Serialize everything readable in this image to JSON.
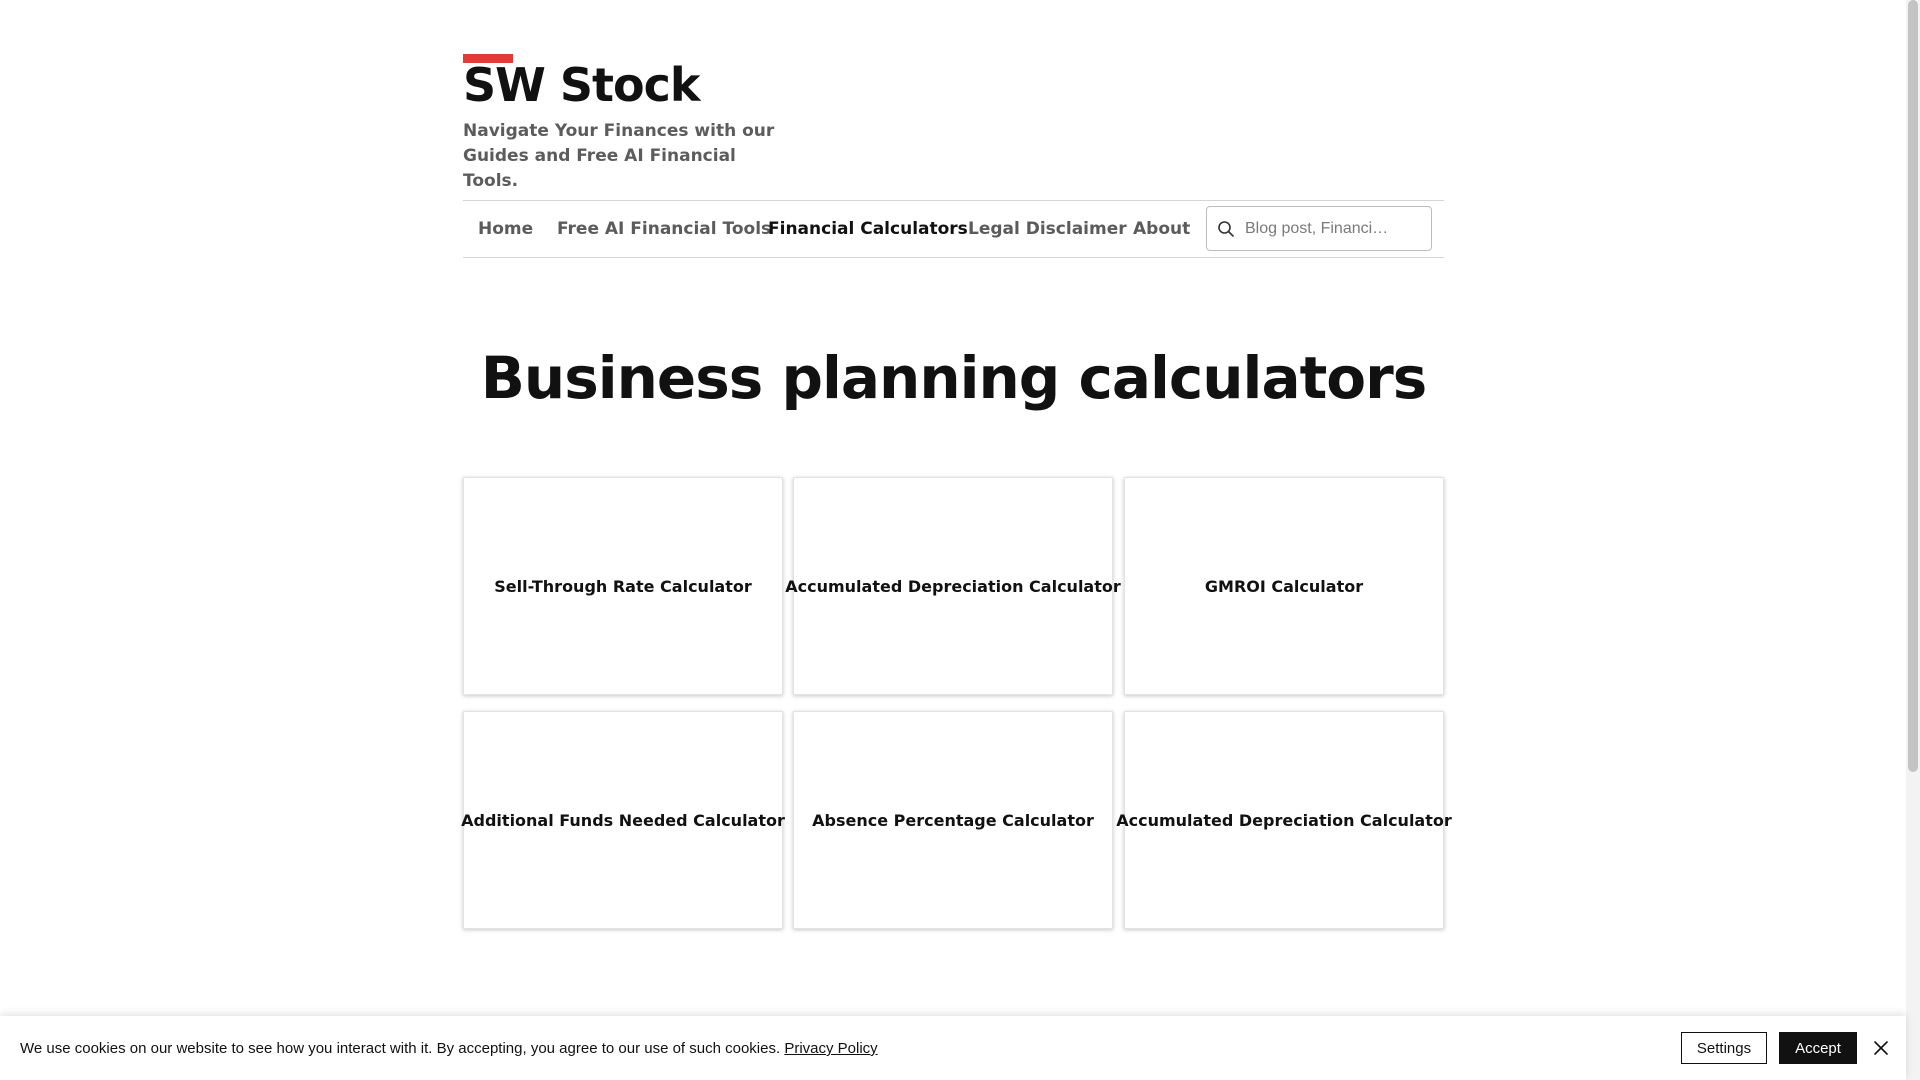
{
  "brand": {
    "name": "SW Stock",
    "tagline": "Navigate Your Finances with our Guides and Free AI Financial Tools.",
    "accent_color": "#e03b36"
  },
  "nav": {
    "items": [
      {
        "label": "Home",
        "active": false
      },
      {
        "label": "Free AI Financial Tools",
        "active": false
      },
      {
        "label": "Financial Calculators",
        "active": true
      },
      {
        "label": "Legal Disclaimer",
        "active": false
      },
      {
        "label": "About",
        "active": false
      }
    ],
    "search": {
      "placeholder": "Blog post, Financi…",
      "icon": "search-icon"
    }
  },
  "main": {
    "title": "Business planning calculators",
    "cards": [
      {
        "label": "Sell-Through Rate Calculator"
      },
      {
        "label": "Accumulated Depreciation Calculator"
      },
      {
        "label": "GMROI Calculator"
      },
      {
        "label": "Additional Funds Needed Calculator"
      },
      {
        "label": "Absence Percentage Calculator"
      },
      {
        "label": "Accumulated Depreciation Calculator"
      }
    ]
  },
  "cookie_banner": {
    "text": "We use cookies on our website to see how you interact with it. By accepting, you agree to our use of such cookies.",
    "link_label": "Privacy Policy",
    "settings_label": "Settings",
    "accept_label": "Accept",
    "close_icon": "close-icon"
  }
}
